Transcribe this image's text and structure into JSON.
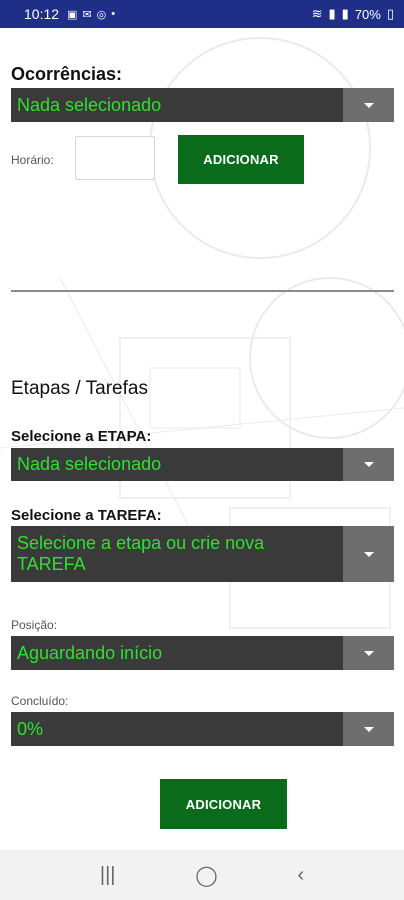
{
  "status_bar": {
    "time": "10:12",
    "battery": "70%"
  },
  "occurrences": {
    "title": "Ocorrências:",
    "selected": "Nada selecionado",
    "time_label": "Horário:",
    "time_value": "",
    "add_button": "ADICIONAR"
  },
  "stages": {
    "title": "Etapas / Tarefas",
    "stage_label": "Selecione a ETAPA:",
    "stage_selected": "Nada selecionado",
    "task_label": "Selecione a TAREFA:",
    "task_selected": "Selecione a etapa ou crie nova TAREFA",
    "position_label": "Posição:",
    "position_selected": "Aguardando início",
    "completed_label": "Concluído:",
    "completed_selected": "0%",
    "add_button": "ADICIONAR"
  },
  "colors": {
    "status_bar": "#1f2f88",
    "dropdown_bg": "#3a3a3a",
    "dropdown_text": "#2ee12e",
    "button_bg": "#0a6b1a"
  }
}
